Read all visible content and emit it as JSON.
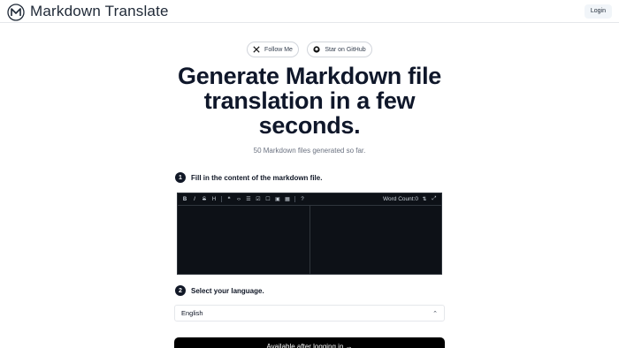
{
  "header": {
    "brand": "Markdown Translate",
    "logo_icon": "m-logo-icon",
    "login_label": "Login"
  },
  "social": {
    "follow_label": "Follow Me",
    "follow_icon": "x-icon",
    "star_label": "Star on GitHub",
    "star_icon": "github-icon"
  },
  "hero": {
    "title": "Generate Markdown file translation in a few seconds.",
    "subtitle": "50 Markdown files generated so far."
  },
  "step1": {
    "number": "1",
    "label": "Fill in the content of the markdown file."
  },
  "editor": {
    "toolbar": [
      "B",
      "I",
      "S",
      "H",
      "❝",
      "‹›",
      "☰",
      "☑",
      "☐",
      "▣",
      "▦",
      "?"
    ],
    "word_count": "Word Count:0"
  },
  "step2": {
    "number": "2",
    "label": "Select your language."
  },
  "language": {
    "selected": "English"
  },
  "action": {
    "label": "Available after logging in →"
  },
  "colors": {
    "editor_bg": "#0d1117",
    "button_bg": "#000000",
    "accent_dark": "#0f172a"
  }
}
